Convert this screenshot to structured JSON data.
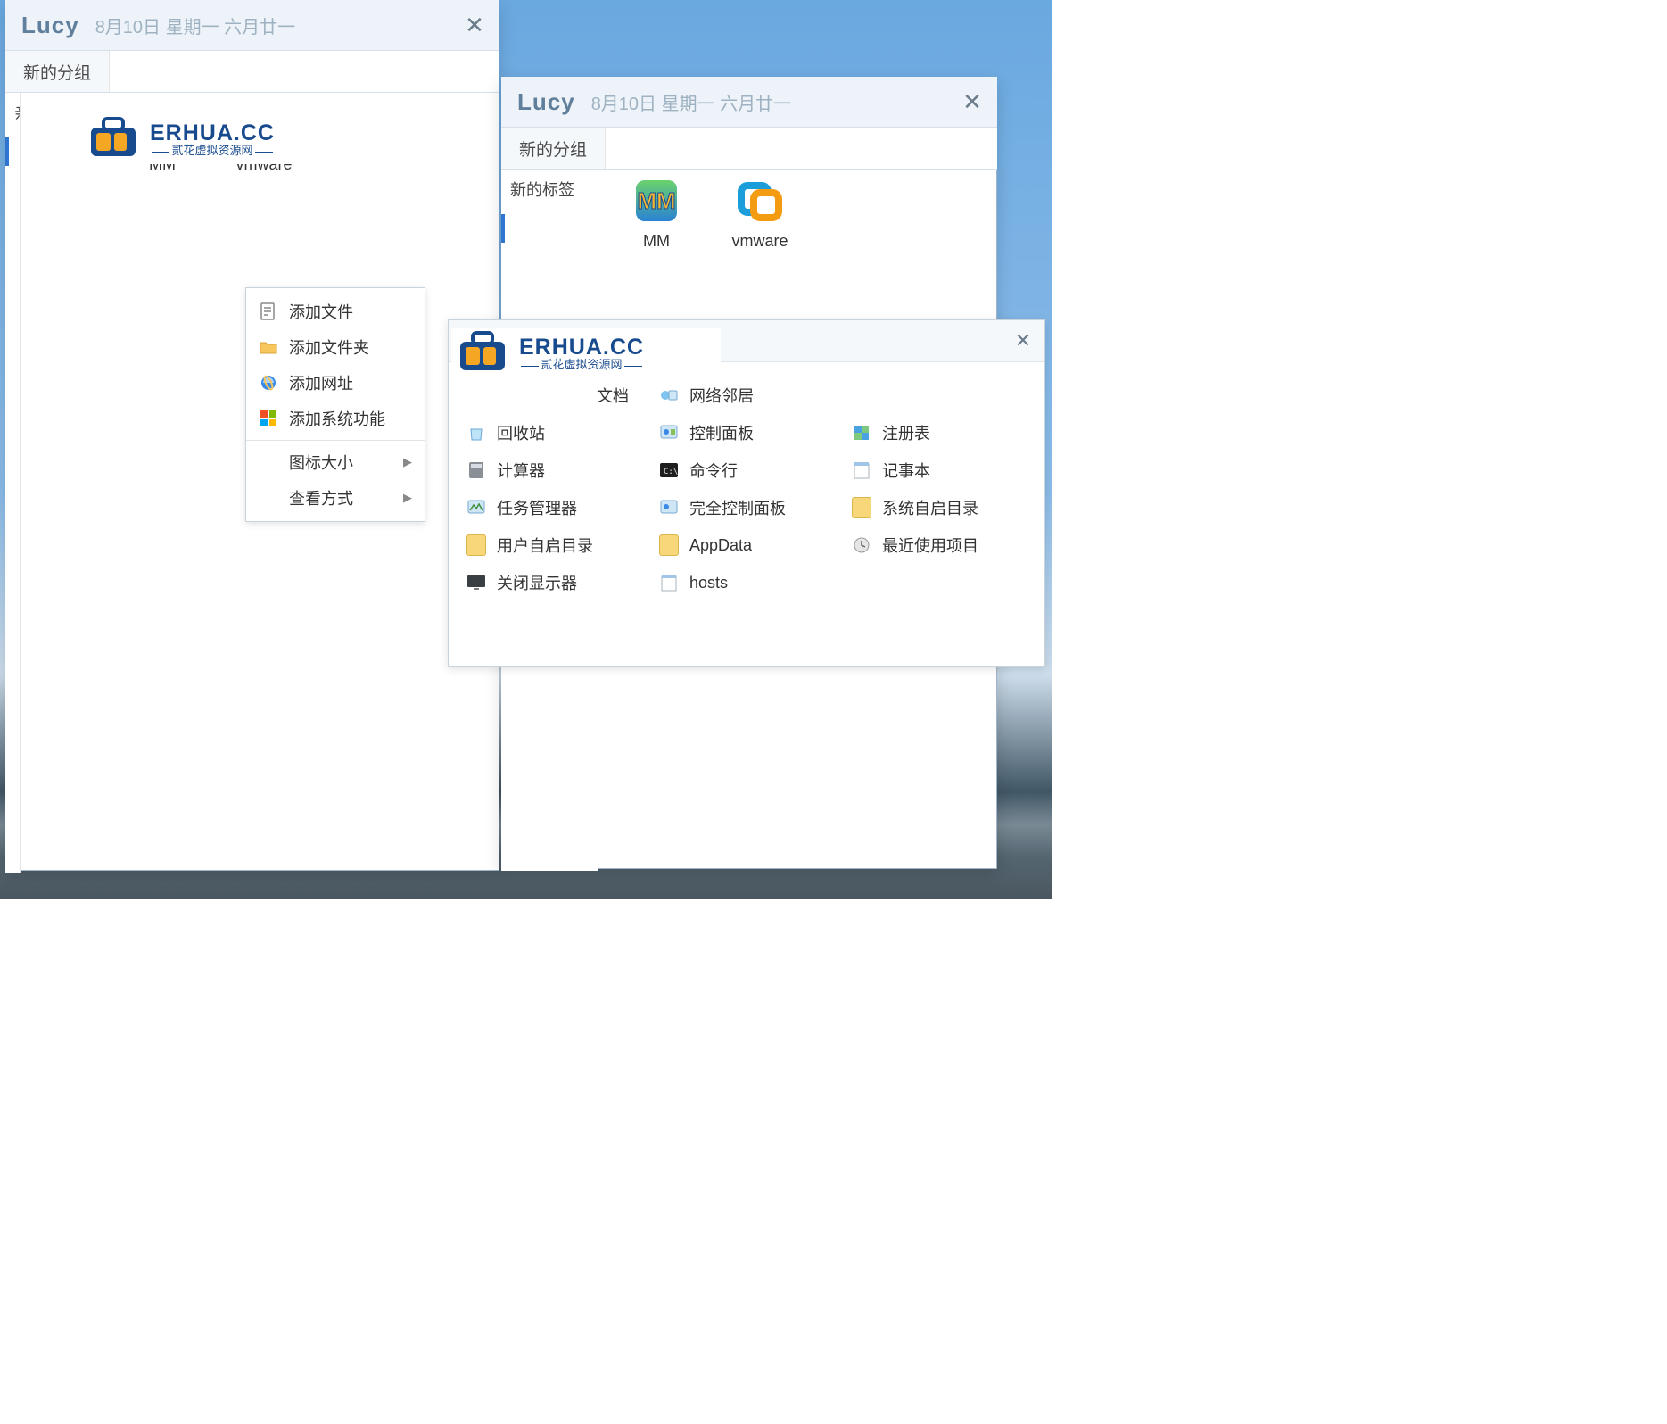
{
  "win1": {
    "title": "Lucy",
    "date": "8月10日 星期一 六月廿一",
    "tab": "新的分组",
    "side_item": "亲",
    "icons": [
      {
        "label": "MM"
      },
      {
        "label": "vmware"
      }
    ]
  },
  "win2": {
    "title": "Lucy",
    "date": "8月10日 星期一 六月廿一",
    "tab": "新的分组",
    "side_item": "新的标签",
    "icons": [
      {
        "label": "MM"
      },
      {
        "label": "vmware"
      }
    ]
  },
  "logo": {
    "brand": "ERHUA.CC",
    "tag": "贰花虚拟资源网"
  },
  "ctx": {
    "add_file": "添加文件",
    "add_folder": "添加文件夹",
    "add_url": "添加网址",
    "add_sys": "添加系统功能",
    "icon_size": "图标大小",
    "view_mode": "查看方式"
  },
  "panel": {
    "col1": [
      {
        "k": "doc_partial",
        "label": "文档"
      },
      {
        "k": "recycle",
        "label": "回收站"
      },
      {
        "k": "calc",
        "label": "计算器"
      },
      {
        "k": "taskmgr",
        "label": "任务管理器"
      },
      {
        "k": "user_startup",
        "label": "用户自启目录"
      },
      {
        "k": "turnoff_display",
        "label": "关闭显示器"
      }
    ],
    "col2": [
      {
        "k": "network_neighborhood",
        "label": "网络邻居"
      },
      {
        "k": "control_panel",
        "label": "控制面板"
      },
      {
        "k": "cmd",
        "label": "命令行"
      },
      {
        "k": "full_control_panel",
        "label": "完全控制面板"
      },
      {
        "k": "appdata",
        "label": "AppData"
      },
      {
        "k": "hosts",
        "label": "hosts"
      }
    ],
    "col3": [
      {
        "k": "registry",
        "label": "注册表"
      },
      {
        "k": "notepad",
        "label": "记事本"
      },
      {
        "k": "sys_startup",
        "label": "系统自启目录"
      },
      {
        "k": "recent",
        "label": "最近使用项目"
      }
    ]
  },
  "colors": {
    "accent": "#2f74d0",
    "orange": "#f39c12",
    "deepblue": "#184b8e"
  }
}
